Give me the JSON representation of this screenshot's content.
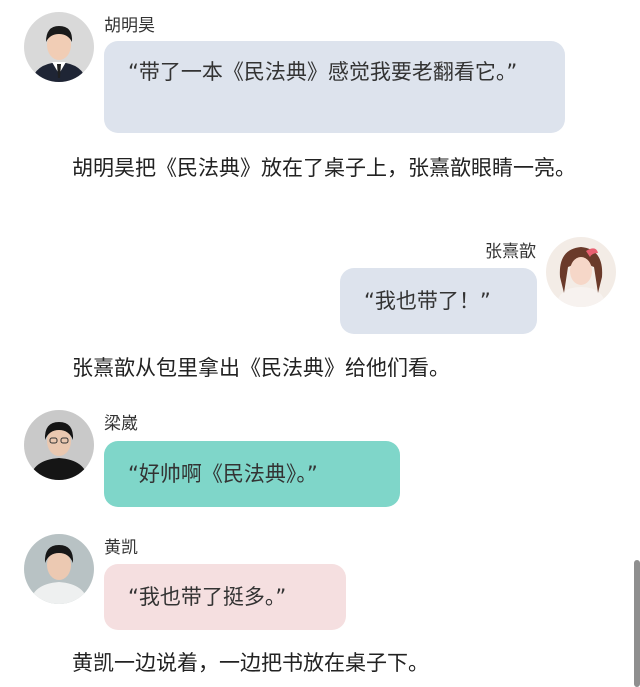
{
  "messages": [
    {
      "speaker": "胡明昊",
      "text": "“带了一本《民法典》感觉我要老翻看它。”",
      "bubble_color": "#dde3ed",
      "avatar": "male-avatar-suit-tie"
    },
    {
      "speaker": "张熹歆",
      "text": "“我也带了！”",
      "bubble_color": "#dde3ed",
      "avatar": "female-avatar"
    },
    {
      "speaker": "梁崴",
      "text": "“好帅啊《民法典》。”",
      "bubble_color": "#7fd6c9",
      "avatar": "male-avatar-black-shirt"
    },
    {
      "speaker": "黄凯",
      "text": "“我也带了挺多。”",
      "bubble_color": "#f5dfe0",
      "avatar": "male-avatar-white-shirt"
    }
  ],
  "narrations": [
    "胡明昊把《民法典》放在了桌子上，张熹歆眼睛一亮。",
    "张熹歆从包里拿出《民法典》给他们看。",
    "黄凯一边说着，一边把书放在桌子下。"
  ]
}
